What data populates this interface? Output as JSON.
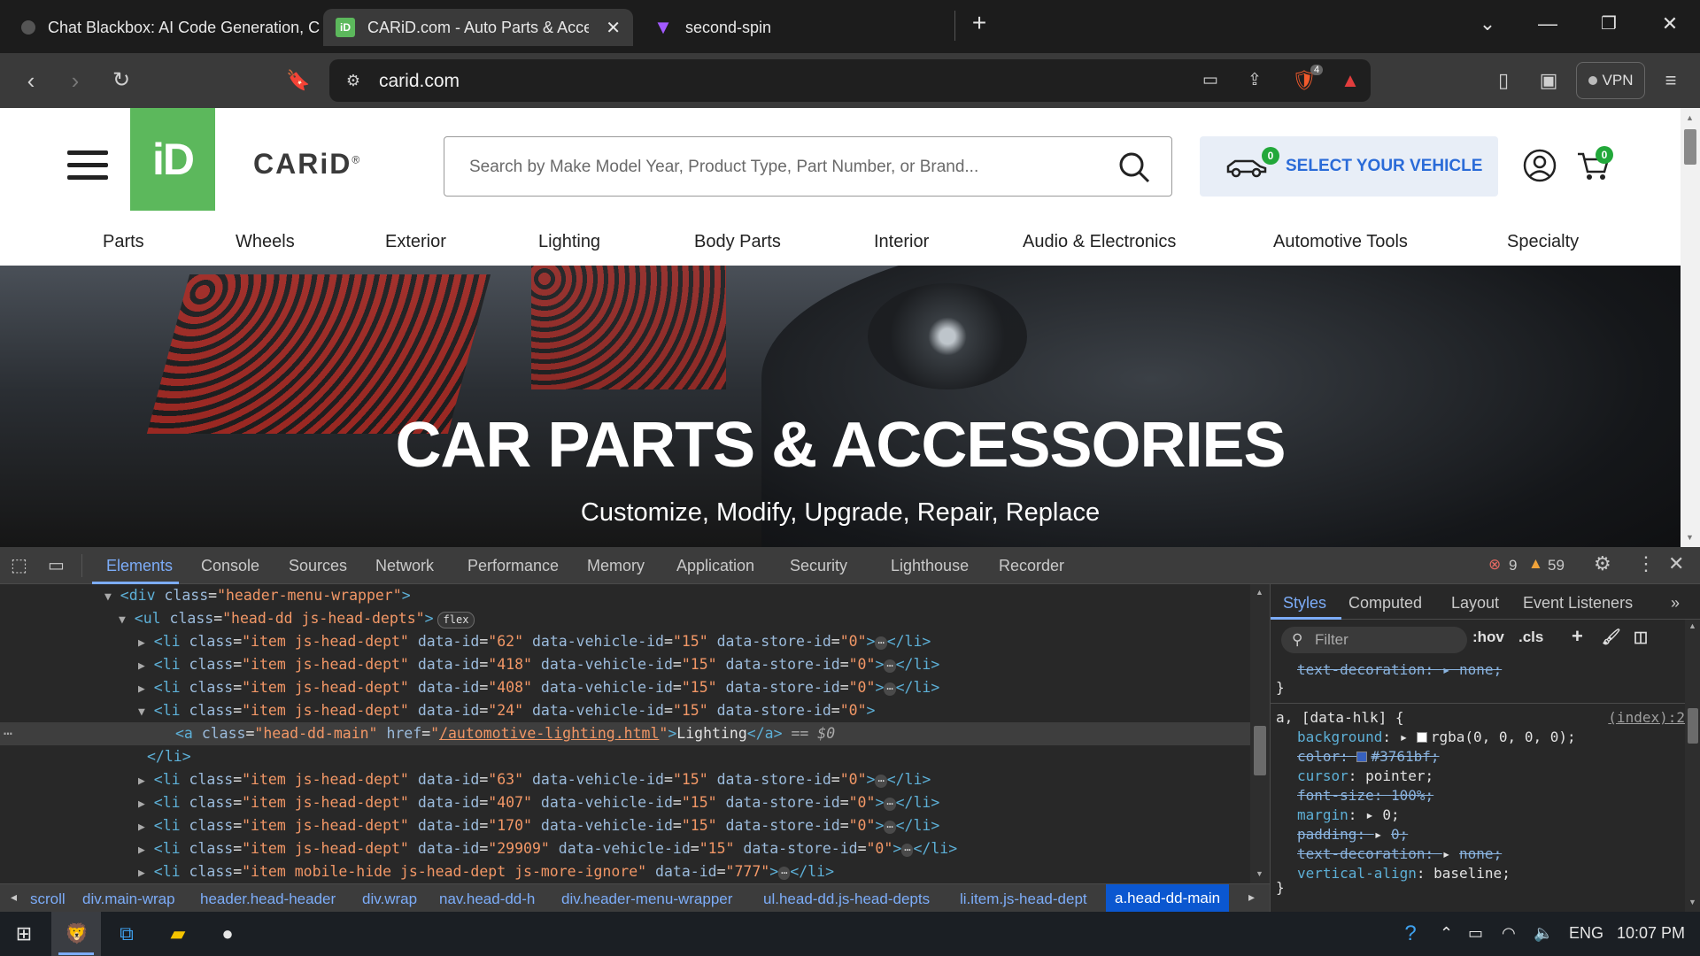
{
  "browser": {
    "tabs": [
      {
        "title": "Chat Blackbox: AI Code Generation, C",
        "active": false
      },
      {
        "title": "CARiD.com - Auto Parts & Acces",
        "active": true
      },
      {
        "title": "second-spin",
        "active": false
      }
    ],
    "url": "carid.com",
    "brave_badge": "4",
    "vpn_label": "VPN"
  },
  "site": {
    "logo_icon": "iD",
    "logo_text": "CARiD",
    "logo_mark": "®",
    "search_placeholder": "Search by Make Model Year, Product Type, Part Number, or Brand...",
    "vehicle_label": "SELECT YOUR VEHICLE",
    "vehicle_count": "0",
    "cart_count": "0",
    "nav": [
      "Parts",
      "Wheels",
      "Exterior",
      "Lighting",
      "Body Parts",
      "Interior",
      "Audio & Electronics",
      "Automotive Tools",
      "Specialty"
    ],
    "hero_title": "CAR PARTS & ACCESSORIES",
    "hero_subtitle": "Customize, Modify, Upgrade, Repair, Replace"
  },
  "devtools": {
    "tabs": [
      "Elements",
      "Console",
      "Sources",
      "Network",
      "Performance",
      "Memory",
      "Application",
      "Security",
      "Lighthouse",
      "Recorder"
    ],
    "active_tab": "Elements",
    "errors": "9",
    "warnings": "59",
    "dom_lines": [
      {
        "indent": 0,
        "arrow": "▼",
        "html": "<div class=\"header-menu-wrapper\">"
      },
      {
        "indent": 1,
        "arrow": "▼",
        "html": "<ul class=\"head-dd js-head-depts\">",
        "badge": "flex"
      },
      {
        "indent": 2,
        "arrow": "▶",
        "id": "62"
      },
      {
        "indent": 2,
        "arrow": "▶",
        "id": "418"
      },
      {
        "indent": 2,
        "arrow": "▶",
        "id": "408"
      },
      {
        "indent": 2,
        "arrow": "▼",
        "id": "24",
        "open": true
      },
      {
        "indent": 3,
        "selected": true
      },
      {
        "indent": 2,
        "close": "</li>"
      },
      {
        "indent": 2,
        "arrow": "▶",
        "id": "63"
      },
      {
        "indent": 2,
        "arrow": "▶",
        "id": "407"
      },
      {
        "indent": 2,
        "arrow": "▶",
        "id": "170"
      },
      {
        "indent": 2,
        "arrow": "▶",
        "id": "29909"
      },
      {
        "indent": 2,
        "arrow": "▶",
        "mobile": true,
        "id": "777"
      }
    ],
    "selected_link": {
      "class": "head-dd-main",
      "href": "/automotive-lighting.html",
      "text": "Lighting",
      "suffix": "== $0"
    },
    "li_class": "item js-head-dept",
    "li_class_mobile": "item mobile-hide js-head-dept js-more-ignore",
    "vehicle_id": "15",
    "store_id": "0",
    "breadcrumb": [
      "scroll",
      "div.main-wrap",
      "header.head-header",
      "div.wrap",
      "nav.head-dd-h",
      "div.header-menu-wrapper",
      "ul.head-dd.js-head-depts",
      "li.item.js-head-dept",
      "a.head-dd-main"
    ],
    "styles_tabs": [
      "Styles",
      "Computed",
      "Layout",
      "Event Listeners"
    ],
    "filter_placeholder": "Filter",
    "hov": ":hov",
    "cls": ".cls",
    "style_top_prop": "text-decoration",
    "style_top_val": "none;",
    "rule_selector": "a, [data-hlk] {",
    "rule_source": "(index):2",
    "rule_props": [
      {
        "name": "background",
        "value": "rgba(0, 0, 0, 0);",
        "struck": false,
        "swatch": "#000000"
      },
      {
        "name": "color",
        "value": "#3761bf;",
        "struck": true,
        "swatch": "#3761bf"
      },
      {
        "name": "cursor",
        "value": "pointer;",
        "struck": false
      },
      {
        "name": "font-size",
        "value": "100%;",
        "struck": true
      },
      {
        "name": "margin",
        "value": "0;",
        "struck": false,
        "expand": true
      },
      {
        "name": "padding",
        "value": "0;",
        "struck": true,
        "expand": true
      },
      {
        "name": "text-decoration",
        "value": "none;",
        "struck": true,
        "expand": true
      },
      {
        "name": "vertical-align",
        "value": "baseline;",
        "struck": false
      }
    ]
  },
  "taskbar": {
    "lang": "ENG",
    "time": "10:07 PM"
  }
}
